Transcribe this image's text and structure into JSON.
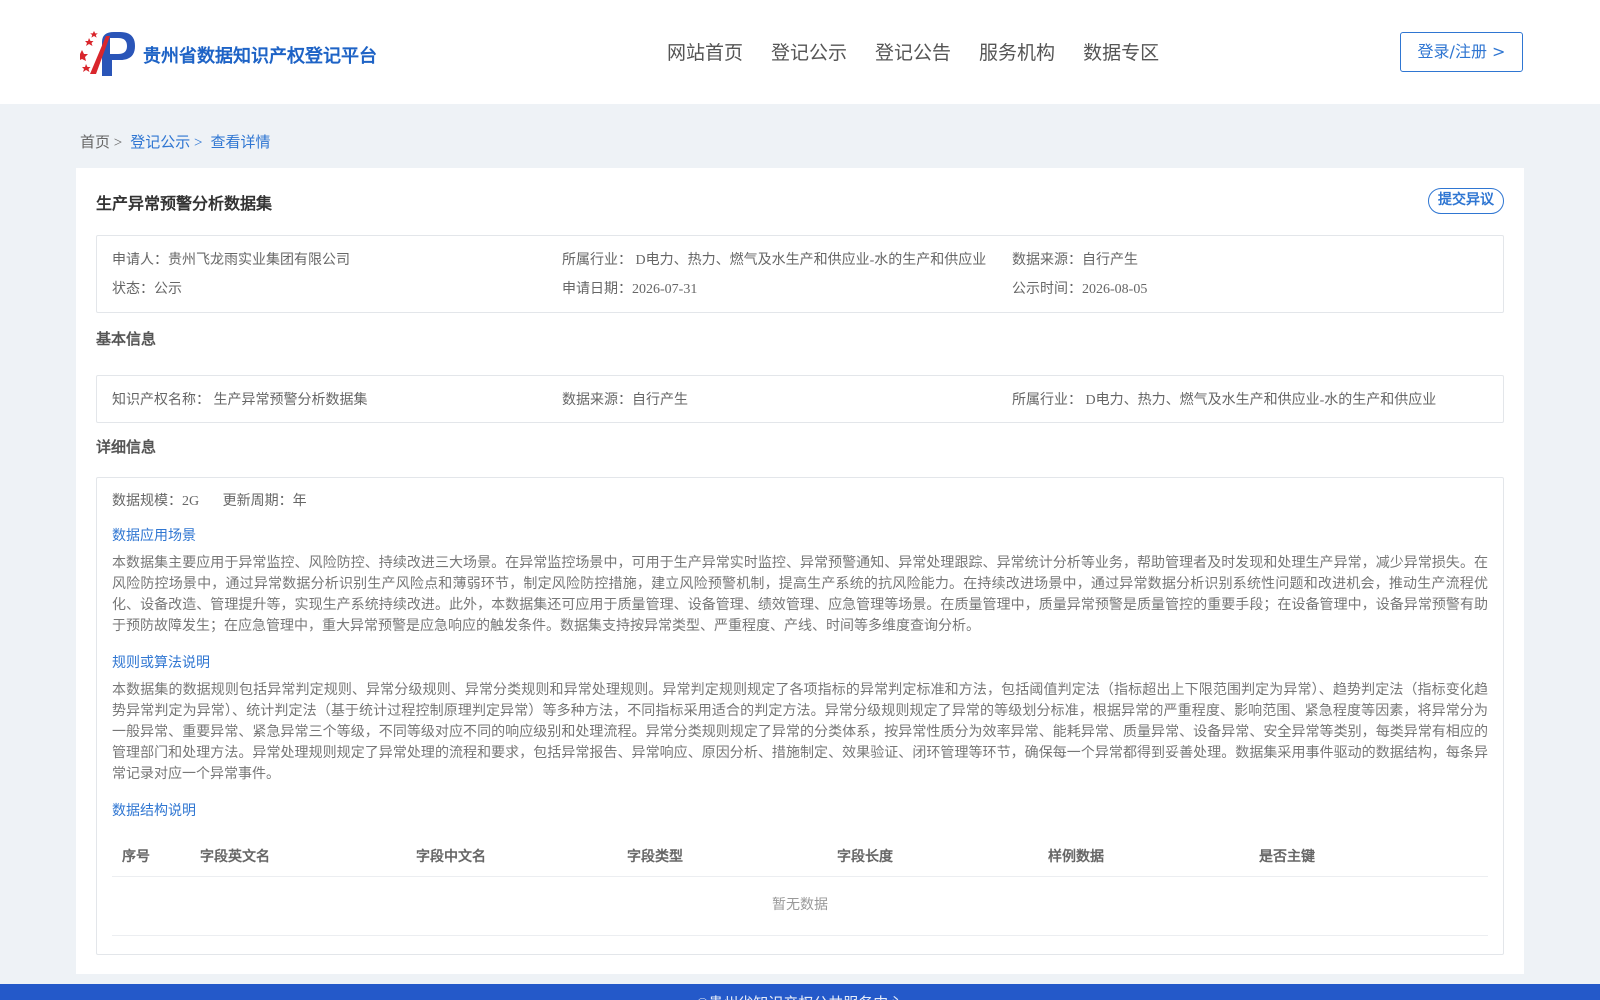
{
  "header": {
    "site_title": "贵州省数据知识产权登记平台",
    "nav": [
      "网站首页",
      "登记公示",
      "登记公告",
      "服务机构",
      "数据专区"
    ],
    "login_label": "登录/注册 >"
  },
  "breadcrumb": {
    "home": "首页 >",
    "list": "登记公示 >",
    "current": "查看详情"
  },
  "dataset": {
    "title": "生产异常预警分析数据集",
    "objection_label": "提交异议",
    "summary": {
      "applicant": "申请人：贵州飞龙雨实业集团有限公司",
      "industry": "所属行业： D电力、热力、燃气及水生产和供应业-水的生产和供应业",
      "source": "数据来源：自行产生",
      "status": "状态：公示",
      "apply_date": "申请日期：2026-07-31",
      "publish_date": "公示时间：2026-08-05"
    }
  },
  "basic_info": {
    "heading": "基本信息",
    "ip_name": "知识产权名称： 生产异常预警分析数据集",
    "source": "数据来源：自行产生",
    "industry": "所属行业： D电力、热力、燃气及水生产和供应业-水的生产和供应业"
  },
  "detail_info": {
    "heading": "详细信息",
    "scale": "数据规模：2G",
    "period": "更新周期：年",
    "scenario_heading": "数据应用场景",
    "scenario_text": "本数据集主要应用于异常监控、风险防控、持续改进三大场景。在异常监控场景中，可用于生产异常实时监控、异常预警通知、异常处理跟踪、异常统计分析等业务，帮助管理者及时发现和处理生产异常，减少异常损失。在风险防控场景中，通过异常数据分析识别生产风险点和薄弱环节，制定风险防控措施，建立风险预警机制，提高生产系统的抗风险能力。在持续改进场景中，通过异常数据分析识别系统性问题和改进机会，推动生产流程优化、设备改造、管理提升等，实现生产系统持续改进。此外，本数据集还可应用于质量管理、设备管理、绩效管理、应急管理等场景。在质量管理中，质量异常预警是质量管控的重要手段；在设备管理中，设备异常预警有助于预防故障发生；在应急管理中，重大异常预警是应急响应的触发条件。数据集支持按异常类型、严重程度、产线、时间等多维度查询分析。",
    "rule_heading": "规则或算法说明",
    "rule_text": "本数据集的数据规则包括异常判定规则、异常分级规则、异常分类规则和异常处理规则。异常判定规则规定了各项指标的异常判定标准和方法，包括阈值判定法（指标超出上下限范围判定为异常）、趋势判定法（指标变化趋势异常判定为异常）、统计判定法（基于统计过程控制原理判定异常）等多种方法，不同指标采用适合的判定方法。异常分级规则规定了异常的等级划分标准，根据异常的严重程度、影响范围、紧急程度等因素，将异常分为一般异常、重要异常、紧急异常三个等级，不同等级对应不同的响应级别和处理流程。异常分类规则规定了异常的分类体系，按异常性质分为效率异常、能耗异常、质量异常、设备异常、安全异常等类别，每类异常有相应的管理部门和处理方法。异常处理规则规定了异常处理的流程和要求，包括异常报告、异常响应、原因分析、措施制定、效果验证、闭环管理等环节，确保每一个异常都得到妥善处理。数据集采用事件驱动的数据结构，每条异常记录对应一个异常事件。",
    "structure_heading": "数据结构说明",
    "table": {
      "columns": [
        "序号",
        "字段英文名",
        "字段中文名",
        "字段类型",
        "字段长度",
        "样例数据",
        "是否主键"
      ],
      "empty_text": "暂无数据"
    }
  },
  "footer": {
    "text": "©贵州省知识产权公共服务中心"
  },
  "colors": {
    "accent": "#2f76d2",
    "footer_bg": "#2459c9",
    "page_bg": "#eef2f6"
  }
}
